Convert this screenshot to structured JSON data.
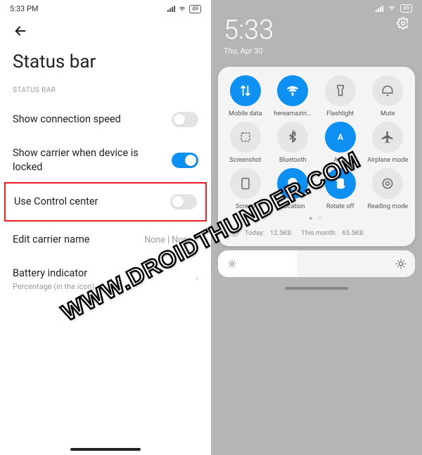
{
  "left": {
    "status_time": "5:33 PM",
    "battery": "49",
    "page_title": "Status bar",
    "section_label": "STATUS BAR",
    "rows": {
      "conn_speed": {
        "label": "Show connection speed"
      },
      "carrier_lock": {
        "label": "Show carrier when device is locked"
      },
      "control_center": {
        "label": "Use Control center"
      },
      "edit_carrier": {
        "label": "Edit carrier name",
        "value": "None | None"
      },
      "battery_ind": {
        "label": "Battery indicator",
        "sub": "Percentage (in the icon)"
      }
    }
  },
  "right": {
    "time": "5:33",
    "date": "Thu, Apr 30",
    "battery": "49",
    "tiles": [
      {
        "name": "mobile-data",
        "label": "Mobile data",
        "on": true
      },
      {
        "name": "wifi",
        "label": "hereamazin...",
        "on": true
      },
      {
        "name": "flashlight",
        "label": "Flashlight",
        "on": false
      },
      {
        "name": "mute",
        "label": "Mute",
        "on": false
      },
      {
        "name": "screenshot",
        "label": "Screenshot",
        "on": false
      },
      {
        "name": "bluetooth",
        "label": "Bluetooth",
        "on": false
      },
      {
        "name": "auto",
        "label": "Auto",
        "on": true
      },
      {
        "name": "airplane",
        "label": "Airplane mode",
        "on": false
      },
      {
        "name": "screen",
        "label": "Screen",
        "on": false
      },
      {
        "name": "location",
        "label": "Location",
        "on": true
      },
      {
        "name": "rotate",
        "label": "Rotate off",
        "on": true
      },
      {
        "name": "reading",
        "label": "Reading mode",
        "on": false
      }
    ],
    "usage": {
      "today_label": "Today:",
      "today": "12.5KB",
      "month_label": "This month:",
      "month": "65.5KB"
    }
  },
  "watermark": "WWW.DROIDTHUNDER.COM"
}
